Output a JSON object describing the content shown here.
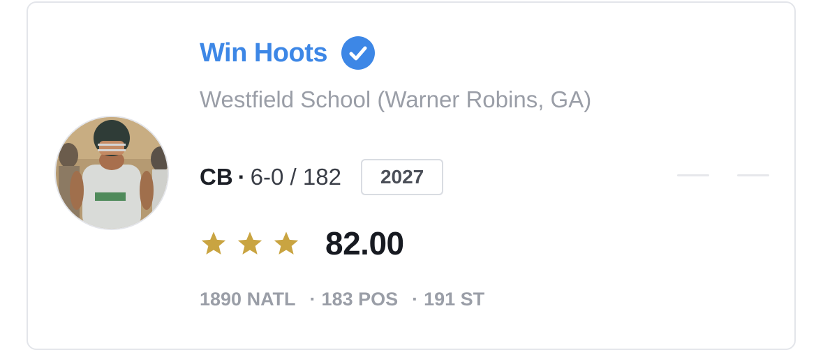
{
  "player": {
    "name": "Win Hoots",
    "verified_icon": "verified-check-icon",
    "school": "Westfield School (Warner Robins, GA)",
    "position": "CB",
    "separator": "·",
    "measurements": "6-0 / 182",
    "class_year": "2027",
    "stars": 3,
    "rating": "82.00",
    "rankings": {
      "national": "1890 NATL",
      "position": "183 POS",
      "state": "191 ST"
    }
  },
  "colors": {
    "name": "#3d87e6",
    "verified_badge": "#3d87e6",
    "star": "#c9a441",
    "muted_text": "#9a9ea7",
    "primary_text": "#1c1f26",
    "border": "#e3e5ea"
  }
}
